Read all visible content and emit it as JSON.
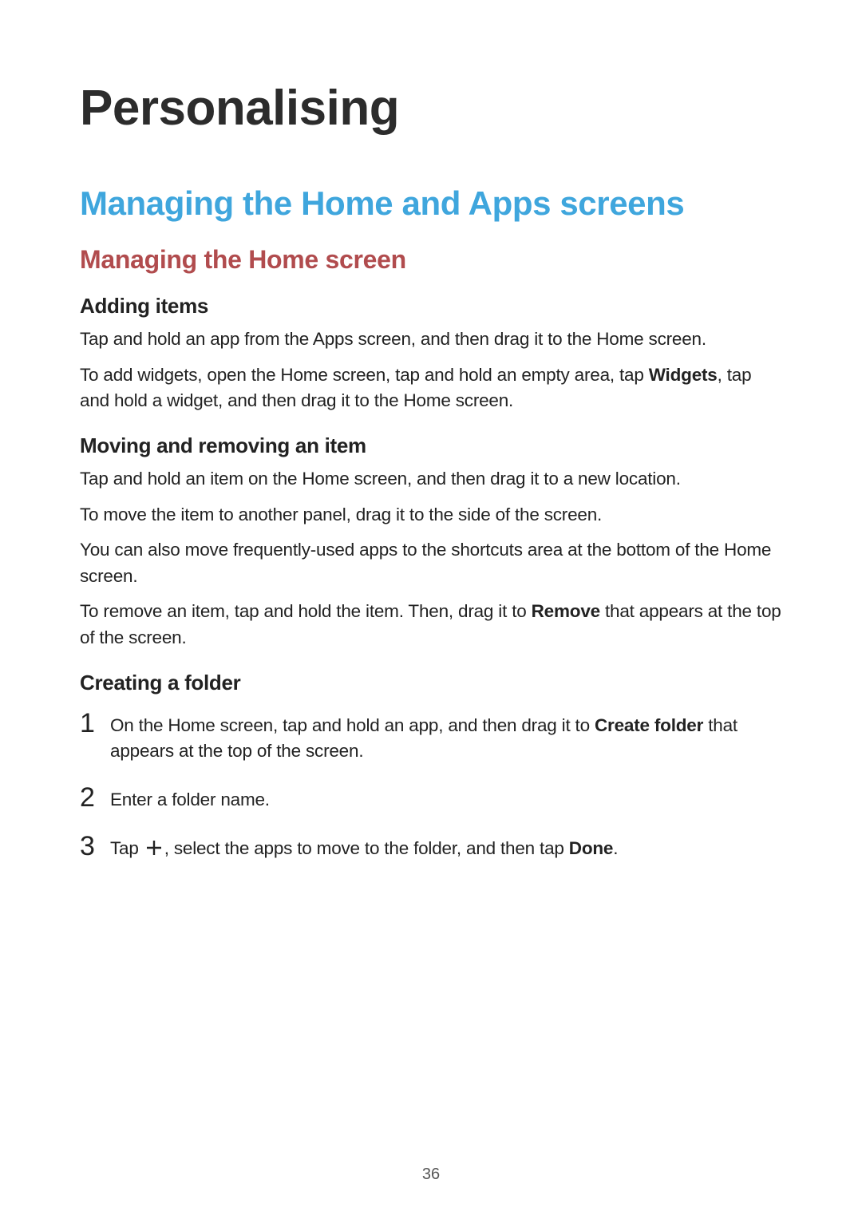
{
  "title": "Personalising",
  "section": "Managing the Home and Apps screens",
  "subsection": "Managing the Home screen",
  "topics": {
    "adding_items": {
      "heading": "Adding items",
      "p1": "Tap and hold an app from the Apps screen, and then drag it to the Home screen.",
      "p2_a": "To add widgets, open the Home screen, tap and hold an empty area, tap ",
      "p2_bold": "Widgets",
      "p2_b": ", tap and hold a widget, and then drag it to the Home screen."
    },
    "moving_removing": {
      "heading": "Moving and removing an item",
      "p1": "Tap and hold an item on the Home screen, and then drag it to a new location.",
      "p2": "To move the item to another panel, drag it to the side of the screen.",
      "p3": "You can also move frequently-used apps to the shortcuts area at the bottom of the Home screen.",
      "p4_a": "To remove an item, tap and hold the item. Then, drag it to ",
      "p4_bold": "Remove",
      "p4_b": " that appears at the top of the screen."
    },
    "creating_folder": {
      "heading": "Creating a folder",
      "steps": {
        "s1_num": "1",
        "s1_a": "On the Home screen, tap and hold an app, and then drag it to ",
        "s1_bold": "Create folder",
        "s1_b": " that appears at the top of the screen.",
        "s2_num": "2",
        "s2_text": "Enter a folder name.",
        "s3_num": "3",
        "s3_a": "Tap ",
        "s3_b": ", select the apps to move to the folder, and then tap ",
        "s3_bold": "Done",
        "s3_c": "."
      }
    }
  },
  "page_number": "36"
}
